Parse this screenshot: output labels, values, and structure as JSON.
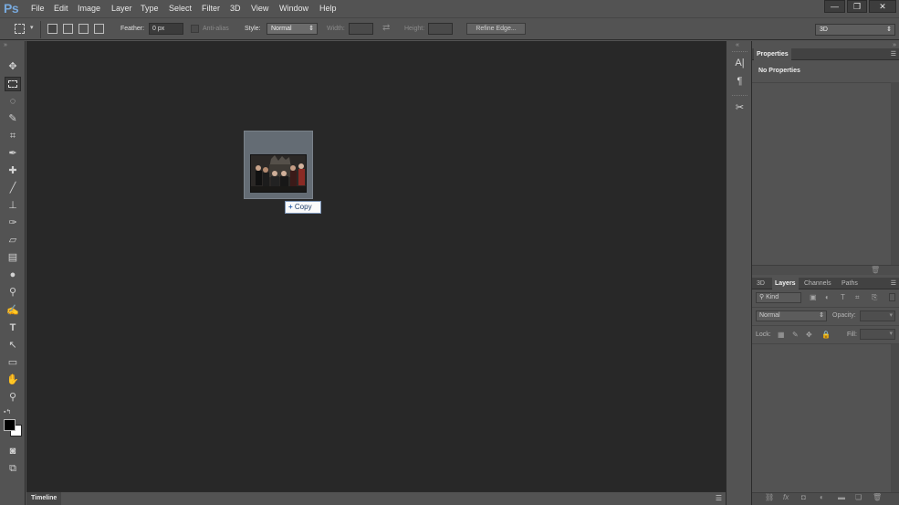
{
  "app": {
    "logo": "Ps"
  },
  "menu": [
    "File",
    "Edit",
    "Image",
    "Layer",
    "Type",
    "Select",
    "Filter",
    "3D",
    "View",
    "Window",
    "Help"
  ],
  "window_controls": {
    "minimize": "—",
    "restore": "❐",
    "close": "✕"
  },
  "options": {
    "feather_label": "Feather:",
    "feather_value": "0 px",
    "antialias_label": "Anti-alias",
    "style_label": "Style:",
    "style_value": "Normal",
    "width_label": "Width:",
    "height_label": "Height:",
    "refine_label": "Refine Edge...",
    "workspace_value": "3D"
  },
  "drag": {
    "copy_label": "Copy",
    "plus": "+"
  },
  "timeline": {
    "tab": "Timeline"
  },
  "properties": {
    "tab": "Properties",
    "heading": "No Properties"
  },
  "layers": {
    "tabs": [
      "3D",
      "Layers",
      "Channels",
      "Paths"
    ],
    "active_tab": "Layers",
    "filter_value": "Kind",
    "blend_value": "Normal",
    "opacity_label": "Opacity:",
    "lock_label": "Lock:",
    "fill_label": "Fill:"
  },
  "colors": {
    "accent": "#78a9dd",
    "canvas": "#282828",
    "chrome": "#535353"
  }
}
